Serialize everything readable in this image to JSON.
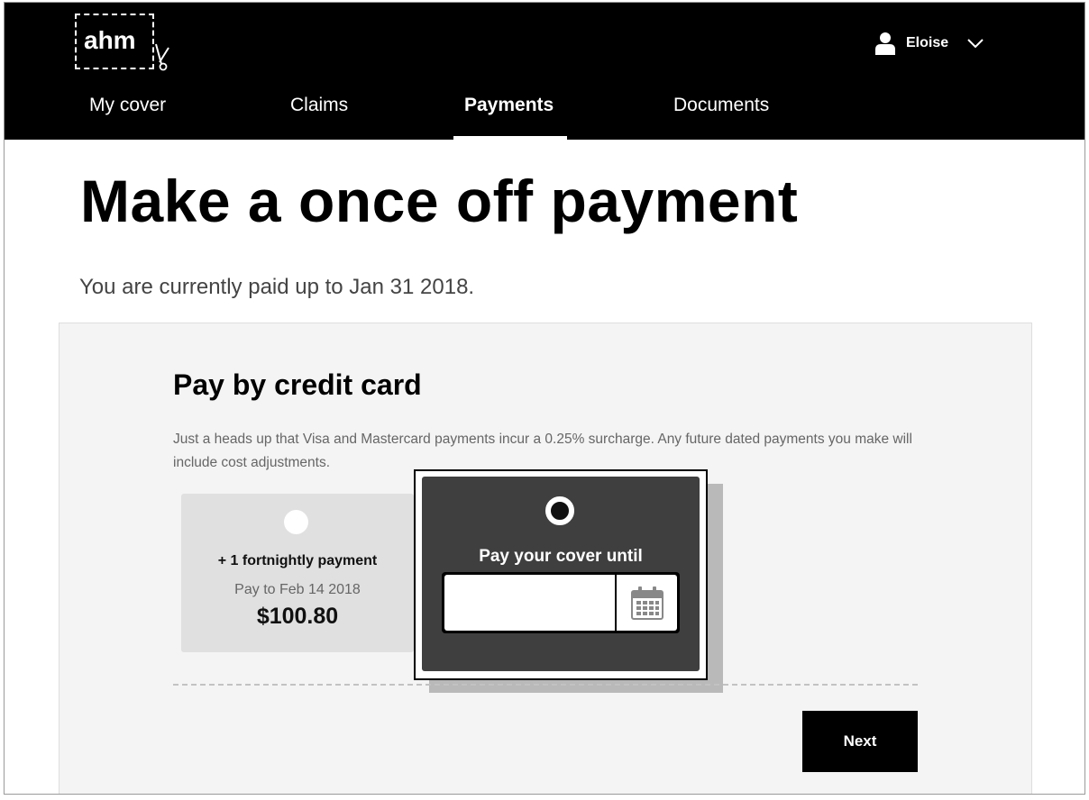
{
  "brand": {
    "logo_text": "ahm"
  },
  "user": {
    "name": "Eloise"
  },
  "nav": {
    "items": [
      {
        "label": "My cover"
      },
      {
        "label": "Claims"
      },
      {
        "label": "Payments",
        "active": true
      },
      {
        "label": "Documents"
      }
    ]
  },
  "page": {
    "title": "Make a once off payment",
    "paid_status": "You are currently paid up to Jan 31 2018."
  },
  "credit_card": {
    "title": "Pay by credit card",
    "surcharge_note": "Just a heads up that Visa and Mastercard payments incur a 0.25% surcharge. Any future dated payments you make will include cost adjustments.",
    "options": [
      {
        "title": "+ 1 fortnightly payment",
        "subtitle": "Pay to Feb 14 2018",
        "amount": "$100.80",
        "selected": false
      },
      {
        "title": "Pay your cover until",
        "date_value": "",
        "selected": true
      }
    ]
  },
  "actions": {
    "next_label": "Next"
  },
  "colors": {
    "header_bg": "#000000",
    "panel_bg": "#f4f4f4",
    "selected_card_bg": "#3f3f3f",
    "unselected_card_bg": "#e0e0e0"
  },
  "icons": {
    "user": "user-icon",
    "chevron": "chevron-down-icon",
    "calendar": "calendar-icon",
    "scissors": "scissors-icon"
  }
}
